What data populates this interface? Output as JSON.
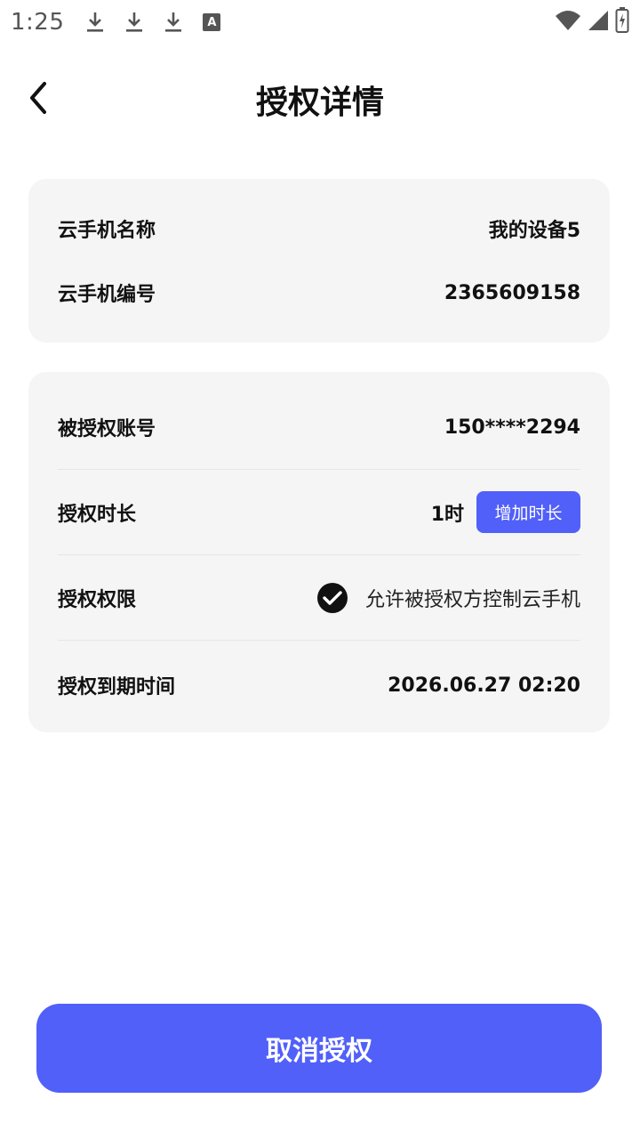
{
  "status_bar": {
    "time": "1:25",
    "left_icons": [
      "download-icon",
      "download-icon",
      "download-icon",
      "a-notification-icon"
    ],
    "a_icon_letter": "A",
    "right_icons": [
      "wifi-icon",
      "signal-icon",
      "battery-charging-icon"
    ]
  },
  "header": {
    "title": "授权详情",
    "back_icon": "chevron-left-icon"
  },
  "device_card": {
    "name_label": "云手机名称",
    "name_value": "我的设备5",
    "id_label": "云手机编号",
    "id_value": "2365609158"
  },
  "auth_card": {
    "account_label": "被授权账号",
    "account_value": "150****2294",
    "duration_label": "授权时长",
    "duration_value": "1时",
    "add_duration_button": "增加时长",
    "permission_label": "授权权限",
    "permission_checked": true,
    "permission_text": "允许被授权方控制云手机",
    "expiry_label": "授权到期时间",
    "expiry_value": "2026.06.27 02:20"
  },
  "footer": {
    "cancel_button": "取消授权"
  },
  "colors": {
    "accent": "#5160f9",
    "card_bg": "#f5f5f5",
    "text": "#111111"
  }
}
